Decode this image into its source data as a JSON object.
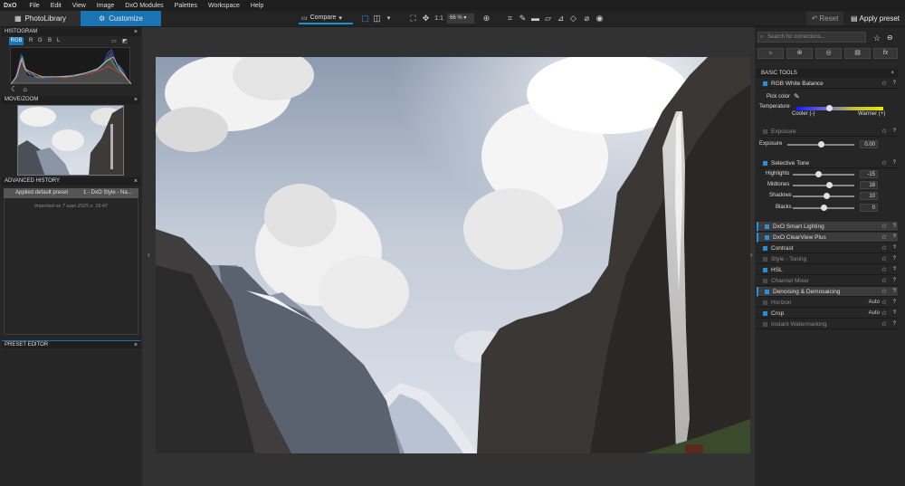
{
  "app": {
    "logo": "DxO"
  },
  "menu": [
    "File",
    "Edit",
    "View",
    "Image",
    "DxO Modules",
    "Palettes",
    "Workspace",
    "Help"
  ],
  "tabs": {
    "photolibrary": "PhotoLibrary",
    "customize": "Customize"
  },
  "toolbar": {
    "compare": "Compare",
    "one_to_one": "1:1",
    "zoom": "66 %",
    "reset": "Reset",
    "apply_preset": "Apply preset"
  },
  "left": {
    "histogram_title": "HISTOGRAM",
    "channels": [
      "RGB",
      "R",
      "G",
      "B",
      "L"
    ],
    "movezoom_title": "MOVE/ZOOM",
    "history_title": "ADVANCED HISTORY",
    "history_item_name": "Applied default preset",
    "history_item_value": "1 - DxO Style - Na...",
    "history_imported": "Imported on 7 шал 2025 г. 15:47",
    "preset_editor_title": "PRESET EDITOR"
  },
  "right": {
    "search_placeholder": "Search for corrections...",
    "section": "BASIC TOOLS",
    "wb": {
      "title": "RGB White Balance",
      "pick_color": "Pick color",
      "temperature": "Temperature",
      "cooler": "Cooler (-)",
      "warmer": "Warmer (+)",
      "temperature_level": 0.38
    },
    "exposure": {
      "title": "Exposure",
      "label": "Exposure",
      "value": "0.00",
      "level": 0.5
    },
    "selective": {
      "title": "Selective Tone",
      "rows": [
        {
          "label": "Highlights",
          "value": "-15",
          "level": 0.42
        },
        {
          "label": "Midtones",
          "value": "18",
          "level": 0.59
        },
        {
          "label": "Shadows",
          "value": "10",
          "level": 0.55
        },
        {
          "label": "Blacks",
          "value": "0",
          "level": 0.5
        }
      ]
    },
    "tools": [
      {
        "label": "DxO Smart Lighting",
        "on": true,
        "hl": true,
        "extra": ""
      },
      {
        "label": "DxO ClearView Plus",
        "on": true,
        "hl": true,
        "extra": ""
      },
      {
        "label": "Contrast",
        "on": true,
        "hl": false,
        "extra": ""
      },
      {
        "label": "Style - Toning",
        "on": false,
        "hl": false,
        "extra": ""
      },
      {
        "label": "HSL",
        "on": true,
        "hl": false,
        "extra": ""
      },
      {
        "label": "Channel Mixer",
        "on": false,
        "hl": false,
        "extra": ""
      },
      {
        "label": "Denoising & Demosaicing",
        "on": true,
        "hl": true,
        "extra": ""
      },
      {
        "label": "Horizon",
        "on": false,
        "hl": false,
        "extra": "Auto"
      },
      {
        "label": "Crop",
        "on": true,
        "hl": false,
        "extra": "Auto"
      },
      {
        "label": "Instant Watermarking",
        "on": false,
        "hl": false,
        "extra": ""
      }
    ]
  },
  "colors": {
    "accent": "#1a74b4",
    "toggle_on": "#2a8fd6"
  }
}
